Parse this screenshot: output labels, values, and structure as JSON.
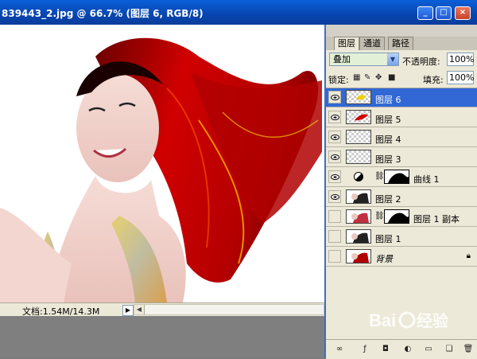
{
  "document": {
    "title": "839443_2.jpg @ 66.7% (图层 6, RGB/8)",
    "status": "文档:1.54M/14.3M"
  },
  "window_buttons": {
    "minimize": "_",
    "maximize": "□",
    "close": "×"
  },
  "layers_panel": {
    "tabs": [
      "图层",
      "通道",
      "路径"
    ],
    "blend_mode": "叠加",
    "opacity_label": "不透明度:",
    "opacity_value": "100%",
    "lock_label": "锁定:",
    "fill_label": "填充:",
    "fill_value": "100%",
    "layers": [
      {
        "name": "图层 6",
        "visible": true,
        "selected": true,
        "kind": "pixel"
      },
      {
        "name": "图层 5",
        "visible": true,
        "selected": false,
        "kind": "pixel"
      },
      {
        "name": "图层 4",
        "visible": true,
        "selected": false,
        "kind": "pixel"
      },
      {
        "name": "图层 3",
        "visible": true,
        "selected": false,
        "kind": "pixel"
      },
      {
        "name": "曲线 1",
        "visible": true,
        "selected": false,
        "kind": "adjustment"
      },
      {
        "name": "图层 2",
        "visible": true,
        "selected": false,
        "kind": "pixel"
      },
      {
        "name": "图层 1 副本",
        "visible": false,
        "selected": false,
        "kind": "masked"
      },
      {
        "name": "图层 1",
        "visible": false,
        "selected": false,
        "kind": "pixel"
      },
      {
        "name": "背景",
        "visible": false,
        "selected": false,
        "kind": "background"
      }
    ],
    "bottom_icons": [
      "link-icon",
      "fx-icon",
      "mask-icon",
      "adjustment-icon",
      "folder-icon",
      "new-layer-icon",
      "trash-icon"
    ]
  },
  "watermark": {
    "text": "Baidu经验"
  },
  "colors": {
    "titlebar": "#0a4fc4",
    "selection": "#3168d5",
    "panel": "#ece9d8",
    "hair": "#c00000"
  }
}
